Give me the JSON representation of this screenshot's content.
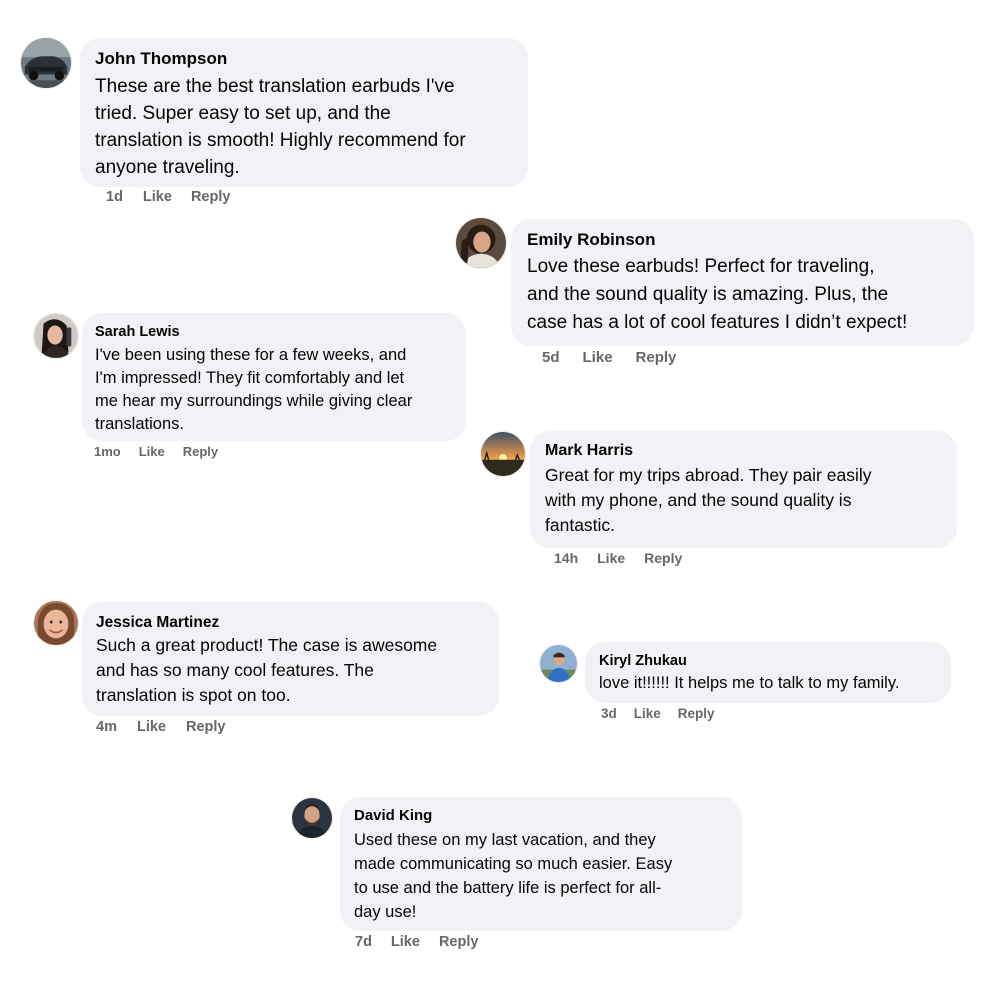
{
  "comments": [
    {
      "author": "John Thompson",
      "lines": [
        "These are the best translation earbuds I've",
        "tried. Super easy to set up, and the",
        "translation is smooth! Highly recommend for",
        "anyone traveling."
      ],
      "time": "1d",
      "like": "Like",
      "reply": "Reply",
      "avatar": "car-photo-avatar"
    },
    {
      "author": "Emily Robinson",
      "lines": [
        "Love these earbuds! Perfect for traveling,",
        "and the sound quality is amazing. Plus, the",
        "case has a lot of cool features I didn’t expect!"
      ],
      "time": "5d",
      "like": "Like",
      "reply": "Reply",
      "avatar": "woman-photo-avatar"
    },
    {
      "author": "Sarah Lewis",
      "lines": [
        "I've been using these for a few weeks, and",
        "I'm impressed! They fit comfortably and let",
        "me hear my surroundings while giving clear",
        "translations."
      ],
      "time": "1mo",
      "like": "Like",
      "reply": "Reply",
      "avatar": "woman-photo-avatar"
    },
    {
      "author": "Mark Harris",
      "lines": [
        "Great for my trips abroad. They pair easily",
        "with my phone, and the sound quality is",
        "fantastic."
      ],
      "time": "14h",
      "like": "Like",
      "reply": "Reply",
      "avatar": "sunset-photo-avatar"
    },
    {
      "author": "Jessica Martinez",
      "lines": [
        "Such a great product! The case is awesome",
        "and has so many cool features. The",
        "translation is spot on too."
      ],
      "time": "4m",
      "like": "Like",
      "reply": "Reply",
      "avatar": "woman-photo-avatar"
    },
    {
      "author": "Kiryl Zhukau",
      "lines": [
        "love it!!!!!! It helps me to talk to my family."
      ],
      "time": "3d",
      "like": "Like",
      "reply": "Reply",
      "avatar": "man-photo-avatar"
    },
    {
      "author": "David King",
      "lines": [
        "Used these on my last vacation, and they",
        "made communicating so much easier. Easy",
        "to use and the battery life is perfect for all-",
        "day use!"
      ],
      "time": "7d",
      "like": "Like",
      "reply": "Reply",
      "avatar": "man-photo-avatar"
    }
  ],
  "colors": {
    "bubble": "#f0f2f5",
    "meta_text": "#65676b",
    "text": "#050505"
  }
}
